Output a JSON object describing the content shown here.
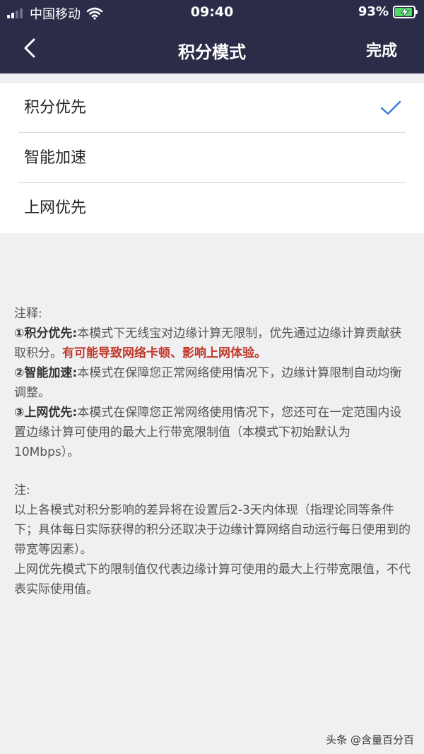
{
  "status_bar": {
    "carrier": "中国移动",
    "time": "09:40",
    "battery": "93%",
    "battery_level": 0.93
  },
  "nav": {
    "title": "积分模式",
    "done_label": "完成"
  },
  "options": [
    {
      "label": "积分优先",
      "selected": true
    },
    {
      "label": "智能加速",
      "selected": false
    },
    {
      "label": "上网优先",
      "selected": false
    }
  ],
  "notes": {
    "heading": "注释:",
    "items": [
      {
        "marker": "①",
        "name": "积分优先:",
        "text": "本模式下无线宝对边缘计算无限制，优先通过边缘计算贡献获取积分。",
        "warning": "有可能导致网络卡顿、影响上网体验。"
      },
      {
        "marker": "②",
        "name": "智能加速:",
        "text": "本模式在保障您正常网络使用情况下，边缘计算限制自动均衡调整。",
        "warning": ""
      },
      {
        "marker": "③",
        "name": "上网优先:",
        "text": "本模式在保障您正常网络使用情况下，您还可在一定范围内设置边缘计算可使用的最大上行带宽限制值（本模式下初始默认为10Mbps）。",
        "warning": ""
      }
    ],
    "note_heading": "注:",
    "note_lines": [
      "以上各模式对积分影响的差异将在设置后2-3天内体现（指理论同等条件下；具体每日实际获得的积分还取决于边缘计算网络自动运行每日使用到的带宽等因素）。",
      "上网优先模式下的限制值仅代表边缘计算可使用的最大上行带宽限值，不代表实际使用值。"
    ]
  },
  "watermark": "头条 @含量百分百",
  "colors": {
    "header_bg": "#2b2d48",
    "check": "#3a7bd5",
    "warning": "#c0392b"
  }
}
